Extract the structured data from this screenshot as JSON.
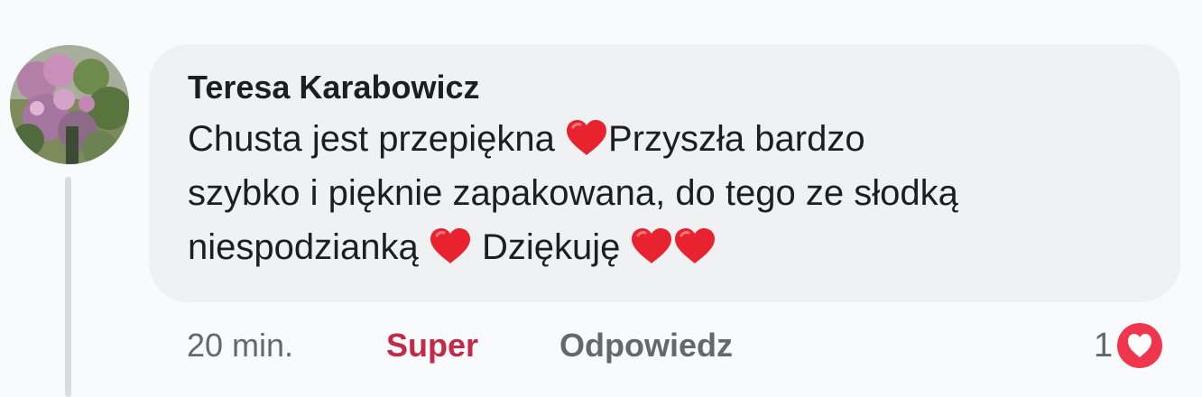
{
  "comment": {
    "author": "Teresa Karabowicz",
    "lines": [
      [
        "Chusta jest przepiękna ",
        "Przyszła bardzo"
      ],
      [
        "szybko i pięknie zapakowana, do tego ze słodką"
      ],
      [
        "niespodzianką ",
        " Dziękuję "
      ]
    ],
    "heart_emoji_icon": "red-heart-emoji",
    "heart_color": "#e8222e"
  },
  "actions": {
    "time": "20 min.",
    "reaction_label": "Super",
    "reaction_color": "#c32a48",
    "reply_label": "Odpowiedz"
  },
  "reactions": {
    "count": "1",
    "icon": "love-reaction-icon",
    "icon_color": "#f0364d"
  }
}
